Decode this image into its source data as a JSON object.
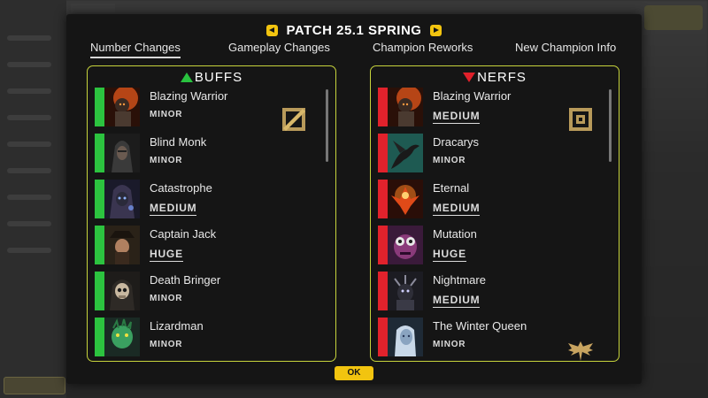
{
  "header": {
    "title": "PATCH 25.1 SPRING"
  },
  "tabs": [
    {
      "label": "Number Changes",
      "active": true
    },
    {
      "label": "Gameplay Changes",
      "active": false
    },
    {
      "label": "Champion Reworks",
      "active": false
    },
    {
      "label": "New Champion Info",
      "active": false
    }
  ],
  "buffs": {
    "title": "BUFFS",
    "color": "#2cc33f",
    "items": [
      {
        "name": "Blazing Warrior",
        "magnitude": "MINOR",
        "icon": "fire-warrior-portrait"
      },
      {
        "name": "Blind Monk",
        "magnitude": "MINOR",
        "icon": "hooded-monk-portrait"
      },
      {
        "name": "Catastrophe",
        "magnitude": "MEDIUM",
        "icon": "hooded-mage-portrait"
      },
      {
        "name": "Captain Jack",
        "magnitude": "HUGE",
        "icon": "pirate-portrait"
      },
      {
        "name": "Death Bringer",
        "magnitude": "MINOR",
        "icon": "skull-portrait"
      },
      {
        "name": "Lizardman",
        "magnitude": "MINOR",
        "icon": "lizard-portrait"
      }
    ]
  },
  "nerfs": {
    "title": "NERFS",
    "color": "#e1222c",
    "items": [
      {
        "name": "Blazing Warrior",
        "magnitude": "MEDIUM",
        "icon": "fire-warrior-portrait"
      },
      {
        "name": "Dracarys",
        "magnitude": "MINOR",
        "icon": "dragon-portrait"
      },
      {
        "name": "Eternal",
        "magnitude": "MEDIUM",
        "icon": "phoenix-portrait"
      },
      {
        "name": "Mutation",
        "magnitude": "HUGE",
        "icon": "mutant-portrait"
      },
      {
        "name": "Nightmare",
        "magnitude": "MEDIUM",
        "icon": "nightmare-portrait"
      },
      {
        "name": "The Winter Queen",
        "magnitude": "MINOR",
        "icon": "ice-queen-portrait"
      }
    ]
  },
  "footer": {
    "ok_label": "OK"
  },
  "colors": {
    "accent": "#f2c40f",
    "panel_border": "#c7d43c"
  }
}
